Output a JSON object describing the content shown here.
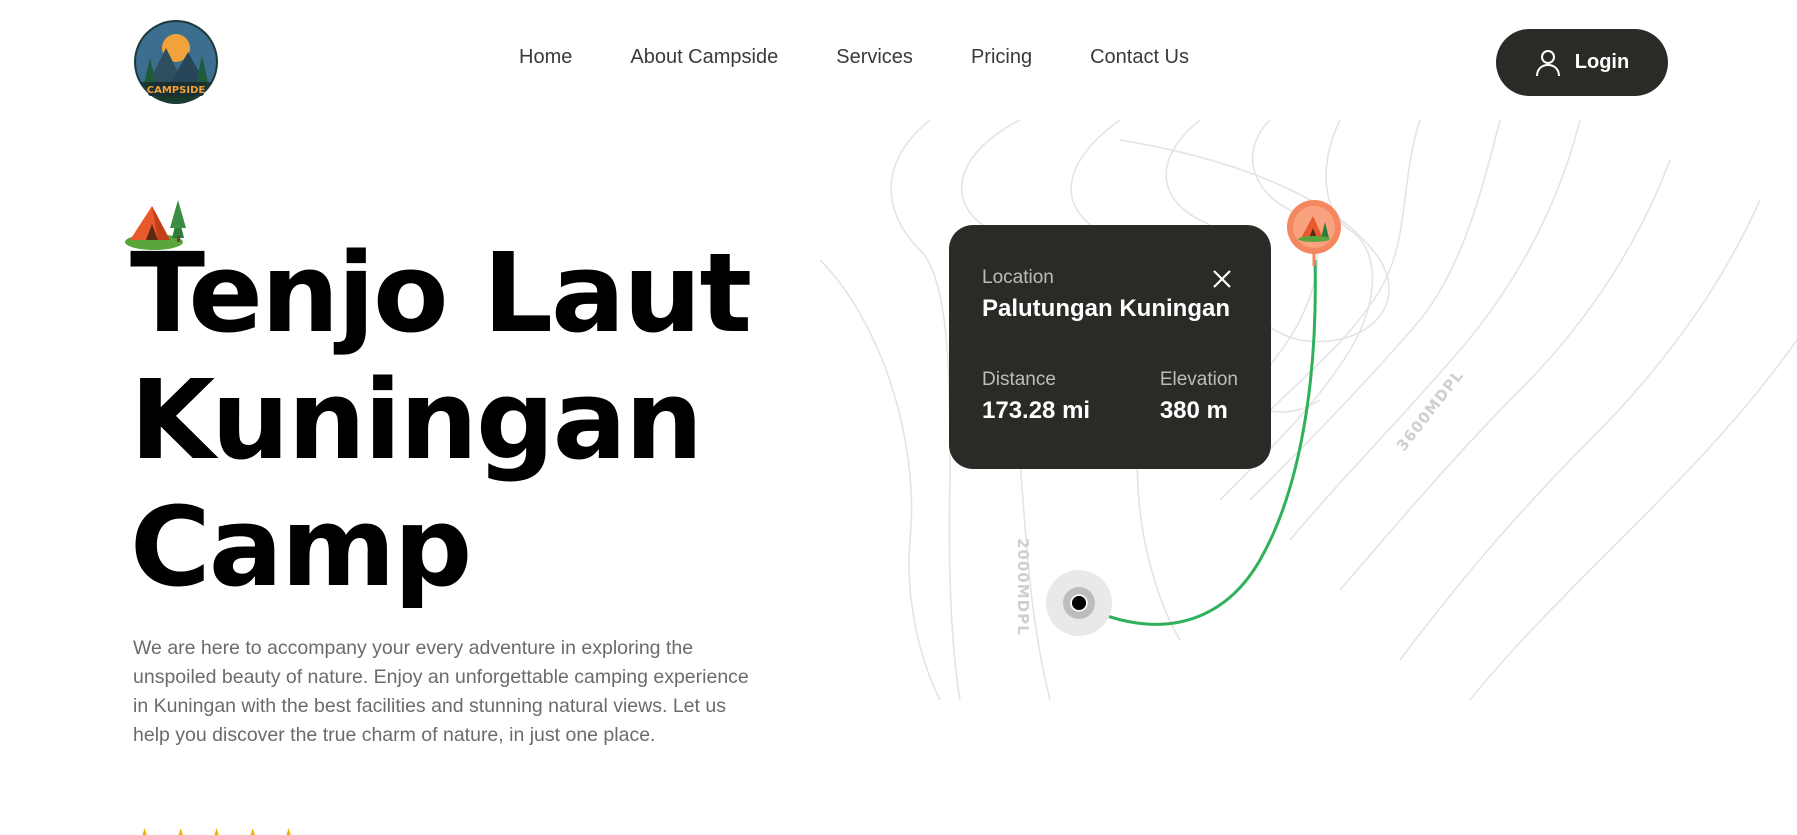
{
  "brand": {
    "logo_text": "CAMPSIDE"
  },
  "nav": {
    "items": [
      {
        "label": "Home"
      },
      {
        "label": "About Campside"
      },
      {
        "label": "Services"
      },
      {
        "label": "Pricing"
      },
      {
        "label": "Contact Us"
      }
    ]
  },
  "header": {
    "login_label": "Login"
  },
  "hero": {
    "title_lines": [
      "Tenjo Laut",
      "Kuningan",
      "Camp"
    ],
    "description": "We are here to accompany your every adventure in exploring the unspoiled beauty of nature. Enjoy an unforgettable camping experience in Kuningan with the best facilities and stunning natural views. Let us help you discover the true charm of nature, in just one place.",
    "rating_stars": 5
  },
  "map_card": {
    "location_label": "Location",
    "location_value": "Palutungan Kuningan",
    "distance_label": "Distance",
    "distance_value": "173.28 mi",
    "elevation_label": "Elevation",
    "elevation_value": "380 m"
  },
  "map": {
    "contour_label_a": "2000MDPL",
    "contour_label_b": "3600MDPL",
    "route_color": "#2fb05a",
    "pin_color": "#f4875f"
  },
  "colors": {
    "dark": "#2a2b26",
    "star": "#f5b400",
    "text_muted": "#6b6b6b"
  },
  "icons": {
    "login": "user-icon",
    "close": "close-icon",
    "pin": "tent-pin-icon",
    "hero": "tent-icon"
  }
}
